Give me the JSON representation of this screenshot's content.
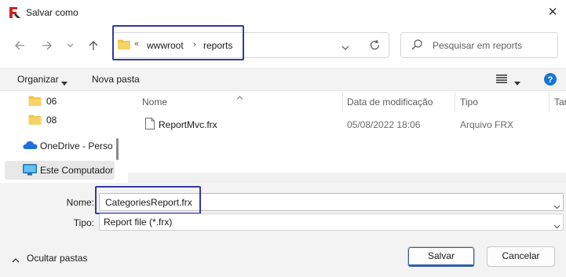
{
  "window": {
    "title": "Salvar como"
  },
  "address": {
    "separator_prefix": "«",
    "crumbs": [
      "wwwroot",
      "reports"
    ],
    "separator": "›"
  },
  "search": {
    "placeholder": "Pesquisar em reports"
  },
  "commandbar": {
    "organize_label": "Organizar",
    "new_folder_label": "Nova pasta"
  },
  "nav": {
    "items": [
      {
        "label": "06",
        "icon": "folder-icon"
      },
      {
        "label": "08",
        "icon": "folder-icon"
      },
      {
        "label": "OneDrive - Persor",
        "icon": "onedrive-cloud-icon"
      },
      {
        "label": "Este Computador",
        "icon": "computer-icon"
      }
    ]
  },
  "columns": [
    "Nome",
    "Data de modificação",
    "Tipo",
    "Tar"
  ],
  "files": [
    {
      "name": "ReportMvc.frx",
      "modified": "05/08/2022 18:06",
      "type": "Arquivo FRX"
    }
  ],
  "form": {
    "name_label": "Nome:",
    "name_value": "CategoriesReport.frx",
    "type_label": "Tipo:",
    "type_value": "Report file (*.frx)"
  },
  "footer": {
    "hide_folders_label": "Ocultar pastas",
    "save_label": "Salvar",
    "cancel_label": "Cancelar"
  },
  "colors": {
    "highlight_border": "#3437a3",
    "primary_accent": "#2c5ea8",
    "folder_yellow": "#f3c448",
    "help_blue": "#1976d2"
  }
}
